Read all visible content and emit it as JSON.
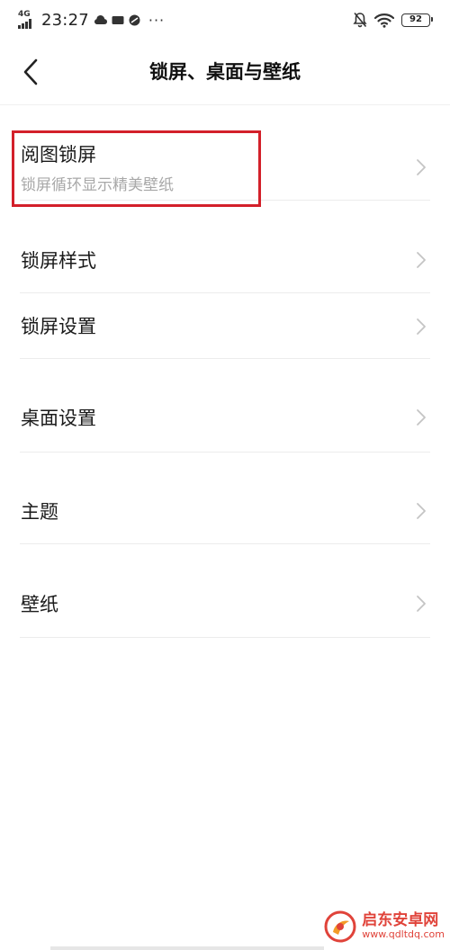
{
  "status_bar": {
    "network": "4G",
    "time": "23:27",
    "more": "···",
    "battery": "92"
  },
  "header": {
    "title": "锁屏、桌面与壁纸"
  },
  "list": [
    {
      "label": "阅图锁屏",
      "sub": "锁屏循环显示精美壁纸"
    },
    {
      "label": "锁屏样式"
    },
    {
      "label": "锁屏设置"
    },
    {
      "label": "桌面设置"
    },
    {
      "label": "主题"
    },
    {
      "label": "壁纸"
    }
  ],
  "watermark": {
    "name": "启东安卓网",
    "url": "www.qdltdq.com"
  },
  "colors": {
    "highlight": "#d3202a",
    "subtext": "#a8a8a8",
    "watermark": "#e0433a"
  },
  "icons": [
    "back-arrow-icon",
    "chevron-right-icon",
    "signal-icon",
    "wifi-icon",
    "mute-bell-icon",
    "battery-icon"
  ]
}
